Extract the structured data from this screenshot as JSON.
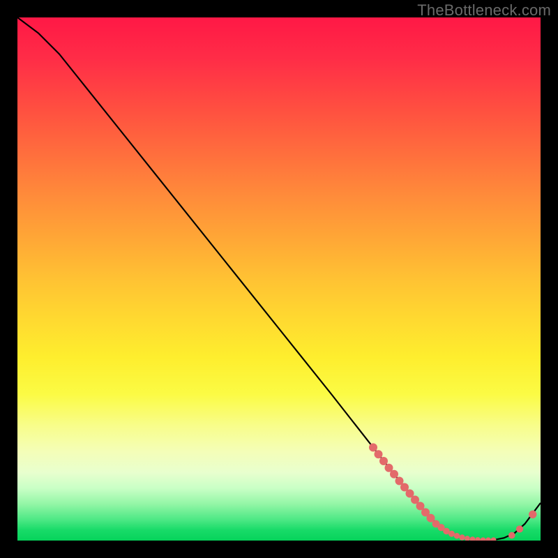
{
  "watermark": "TheBottleneck.com",
  "chart_data": {
    "type": "line",
    "title": "",
    "xlabel": "",
    "ylabel": "",
    "xlim": [
      0,
      100
    ],
    "ylim": [
      0,
      100
    ],
    "series": [
      {
        "name": "curve",
        "x": [
          0,
          4,
          8,
          12,
          20,
          30,
          40,
          50,
          60,
          68,
          72,
          76,
          79,
          81,
          83,
          85,
          87,
          89,
          91,
          93,
          95,
          97,
          100
        ],
        "y": [
          100,
          97,
          93,
          88,
          78,
          65.5,
          53,
          40.5,
          28,
          17.8,
          12.7,
          7.8,
          4.3,
          2.5,
          1.3,
          0.6,
          0.25,
          0.1,
          0.1,
          0.5,
          1.4,
          3.2,
          7.2
        ]
      }
    ],
    "markers": [
      {
        "x": 68.0,
        "y": 17.8,
        "r": 1.0
      },
      {
        "x": 69.0,
        "y": 16.5,
        "r": 1.0
      },
      {
        "x": 70.0,
        "y": 15.2,
        "r": 1.0
      },
      {
        "x": 71.0,
        "y": 13.9,
        "r": 1.0
      },
      {
        "x": 72.0,
        "y": 12.7,
        "r": 1.0
      },
      {
        "x": 73.0,
        "y": 11.4,
        "r": 1.0
      },
      {
        "x": 74.0,
        "y": 10.2,
        "r": 1.0
      },
      {
        "x": 75.0,
        "y": 9.0,
        "r": 1.0
      },
      {
        "x": 76.0,
        "y": 7.8,
        "r": 1.0
      },
      {
        "x": 77.0,
        "y": 6.6,
        "r": 1.0
      },
      {
        "x": 78.0,
        "y": 5.4,
        "r": 1.0
      },
      {
        "x": 79.0,
        "y": 4.3,
        "r": 1.0
      },
      {
        "x": 80.0,
        "y": 3.2,
        "r": 0.9
      },
      {
        "x": 81.0,
        "y": 2.5,
        "r": 0.85
      },
      {
        "x": 82.0,
        "y": 1.8,
        "r": 0.8
      },
      {
        "x": 83.0,
        "y": 1.3,
        "r": 0.75
      },
      {
        "x": 84.0,
        "y": 0.9,
        "r": 0.7
      },
      {
        "x": 85.0,
        "y": 0.6,
        "r": 0.7
      },
      {
        "x": 86.0,
        "y": 0.4,
        "r": 0.65
      },
      {
        "x": 87.0,
        "y": 0.25,
        "r": 0.65
      },
      {
        "x": 88.0,
        "y": 0.15,
        "r": 0.65
      },
      {
        "x": 89.0,
        "y": 0.1,
        "r": 0.65
      },
      {
        "x": 90.0,
        "y": 0.1,
        "r": 0.65
      },
      {
        "x": 91.0,
        "y": 0.1,
        "r": 0.65
      },
      {
        "x": 94.5,
        "y": 1.0,
        "r": 0.8
      },
      {
        "x": 96.0,
        "y": 2.2,
        "r": 0.85
      },
      {
        "x": 98.5,
        "y": 5.0,
        "r": 0.95
      }
    ],
    "colors": {
      "line": "#000000",
      "marker": "#e36a6a"
    }
  }
}
